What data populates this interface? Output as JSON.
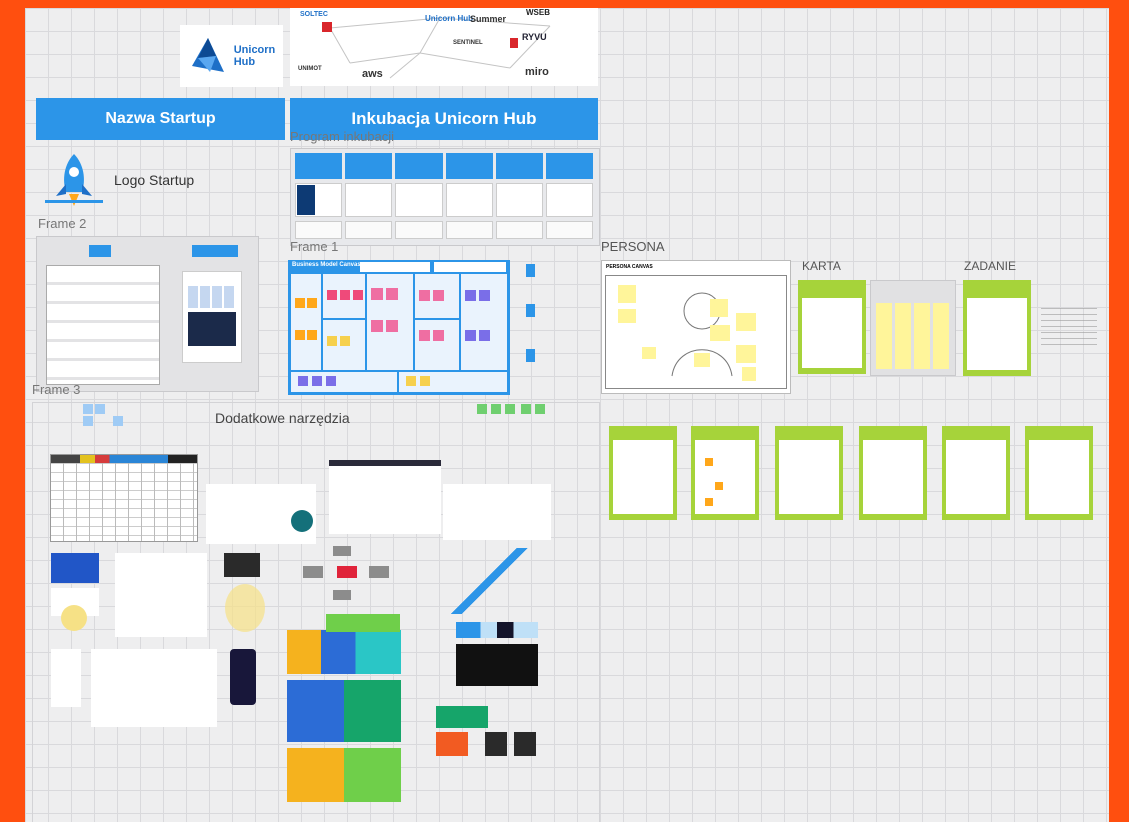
{
  "header_left": {
    "title": "Nazwa Startup"
  },
  "header_right": {
    "title": "Inkubacja Unicorn Hub"
  },
  "brand": {
    "name_line1": "Unicorn",
    "name_line2": "Hub",
    "color": "#1e6fc7"
  },
  "logo_label": "Logo Startup",
  "frames": {
    "program": "Program inkubacji",
    "frame1": "Frame 1",
    "frame2": "Frame 2",
    "frame3": "Frame 3",
    "tools": "Dodatkowe narzędzia",
    "persona": "PERSONA",
    "karta": "KARTA",
    "zadanie": "ZADANIE"
  },
  "partners": [
    "SOLTEC",
    "Unicorn Hub",
    "Summer",
    "WSEB",
    "RYVU",
    "aws",
    "miro",
    "SENTINEL",
    "UNIMOT"
  ],
  "bmc": {
    "title": "Business Model Canvas"
  },
  "persona_canvas": {
    "title": "PERSONA CANVAS"
  },
  "colors": {
    "orange_border": "#ff4f0f",
    "accent_blue": "#2c95e8",
    "card_green": "#a6d33a"
  }
}
